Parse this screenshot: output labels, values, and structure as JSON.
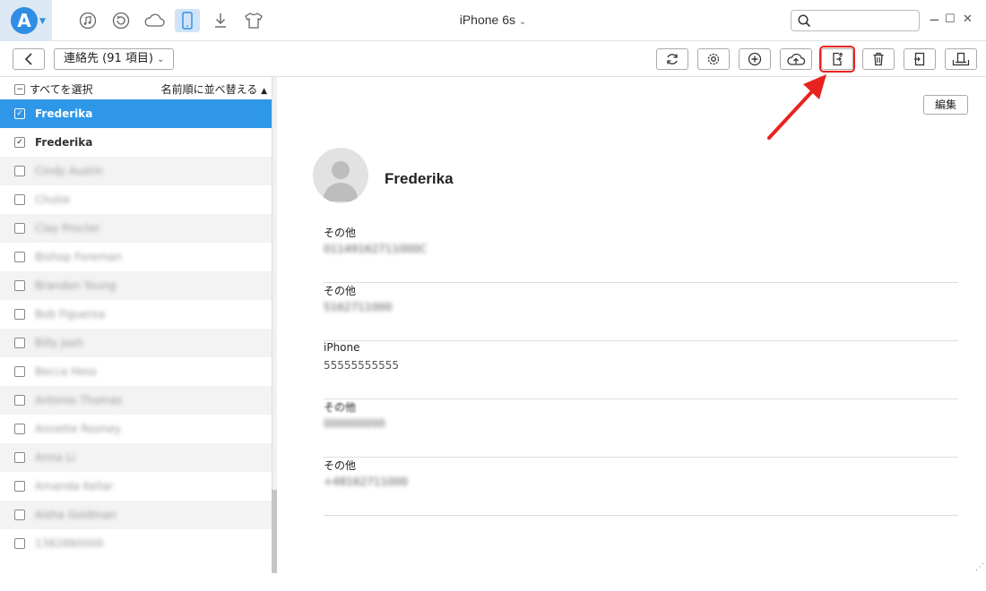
{
  "app": {
    "logo_letter": "A"
  },
  "header": {
    "device_name": "iPhone 6s",
    "nav_icons": [
      "music-icon",
      "restore-icon",
      "cloud-icon",
      "phone-icon",
      "download-icon",
      "tshirt-icon"
    ],
    "window_controls": {
      "minimize": "−",
      "maximize": "☐",
      "close": "✕"
    }
  },
  "toolbar": {
    "category_label": "連絡先 (91 項目)",
    "buttons": [
      "refresh-icon",
      "settings-icon",
      "add-icon",
      "cloud-upload-icon",
      "export-to-computer-icon",
      "trash-icon",
      "import-icon",
      "to-device-icon"
    ]
  },
  "sidebar": {
    "select_all": "すべてを選択",
    "sort_label": "名前順に並べ替える",
    "contacts": [
      {
        "name": "Frederika",
        "checked": true,
        "selected": true,
        "blurred": false
      },
      {
        "name": "Frederika",
        "checked": true,
        "selected": false,
        "blurred": false
      },
      {
        "name": "Cindy Austin",
        "checked": false,
        "selected": false,
        "blurred": true
      },
      {
        "name": "Chutie",
        "checked": false,
        "selected": false,
        "blurred": true
      },
      {
        "name": "Clay Procter",
        "checked": false,
        "selected": false,
        "blurred": true
      },
      {
        "name": "Bishop Foreman",
        "checked": false,
        "selected": false,
        "blurred": true
      },
      {
        "name": "Brandon Young",
        "checked": false,
        "selected": false,
        "blurred": true
      },
      {
        "name": "Bob Figueroa",
        "checked": false,
        "selected": false,
        "blurred": true
      },
      {
        "name": "Billy Josh",
        "checked": false,
        "selected": false,
        "blurred": true
      },
      {
        "name": "Becca Hess",
        "checked": false,
        "selected": false,
        "blurred": true
      },
      {
        "name": "Antonio Thomas",
        "checked": false,
        "selected": false,
        "blurred": true
      },
      {
        "name": "Annette Rooney",
        "checked": false,
        "selected": false,
        "blurred": true
      },
      {
        "name": "Anna Li",
        "checked": false,
        "selected": false,
        "blurred": true
      },
      {
        "name": "Amanda Kellar",
        "checked": false,
        "selected": false,
        "blurred": true
      },
      {
        "name": "Aisha Goldman",
        "checked": false,
        "selected": false,
        "blurred": true
      },
      {
        "name": "1382880000",
        "checked": false,
        "selected": false,
        "blurred": true
      }
    ]
  },
  "detail": {
    "edit_label": "編集",
    "contact_name": "Frederika",
    "fields": [
      {
        "label": "その他",
        "value": "01149162711000C",
        "blurred": true
      },
      {
        "label": "その他",
        "value": "5162711000",
        "blurred": true
      },
      {
        "label": "iPhone",
        "value": "55555555555",
        "blurred": false
      },
      {
        "label": "その他",
        "value": "000000000",
        "blurred": true
      },
      {
        "label": "その他",
        "value": "+48162711000",
        "blurred": true
      }
    ]
  }
}
